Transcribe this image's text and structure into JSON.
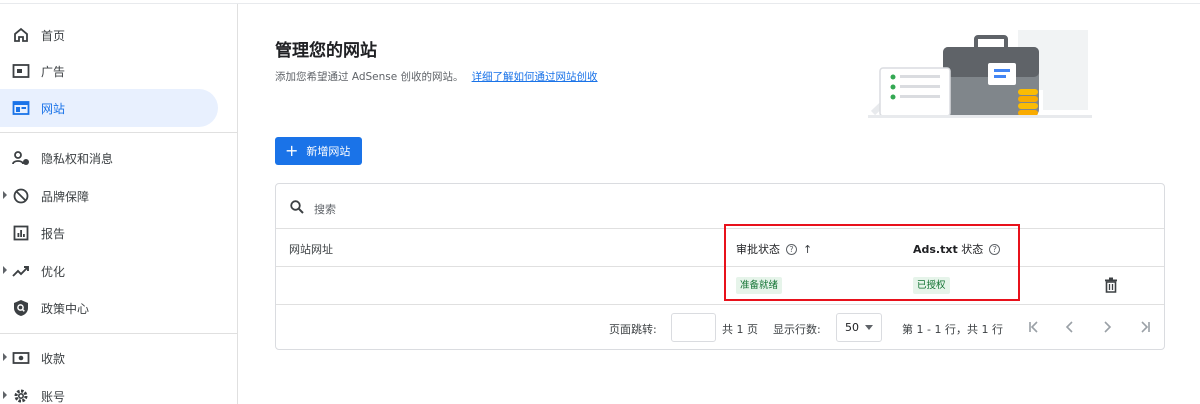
{
  "sidebar": {
    "items": [
      {
        "label": "首页",
        "icon": "home-icon"
      },
      {
        "label": "广告",
        "icon": "ad-unit-icon"
      },
      {
        "label": "网站",
        "icon": "web-icon",
        "active": true
      },
      {
        "label": "隐私权和消息",
        "icon": "privacy-icon"
      },
      {
        "label": "品牌保障",
        "icon": "block-icon",
        "expandable": true
      },
      {
        "label": "报告",
        "icon": "report-icon"
      },
      {
        "label": "优化",
        "icon": "trending-icon",
        "expandable": true
      },
      {
        "label": "政策中心",
        "icon": "policy-icon"
      },
      {
        "label": "收款",
        "icon": "payments-icon",
        "expandable": true
      },
      {
        "label": "账号",
        "icon": "settings-icon",
        "expandable": true
      }
    ]
  },
  "header": {
    "title": "管理您的网站",
    "subtitle": "添加您希望通过 AdSense 创收的网站。",
    "learn_more_link": "详细了解如何通过网站创收"
  },
  "actions": {
    "add_site_label": "新增网站"
  },
  "table": {
    "search_placeholder": "搜索",
    "columns": {
      "url": "网站网址",
      "approval": "审批状态",
      "ads_txt_bold": "Ads.txt",
      "ads_txt_suffix": "状态"
    },
    "rows": [
      {
        "url": "",
        "approval": "准备就绪",
        "ads_txt": "已授权"
      }
    ],
    "pagination": {
      "jump_label": "页面跳转:",
      "jump_value": "",
      "total_pages": "共 1 页",
      "rows_label": "显示行数:",
      "rows_value": "50",
      "range": "第 1 - 1 行，共 1 行"
    }
  },
  "colors": {
    "accent": "#1a73e8",
    "status_ok_bg": "#e6f4ea",
    "status_ok_text": "#137333",
    "highlight_border": "#e8111b"
  }
}
